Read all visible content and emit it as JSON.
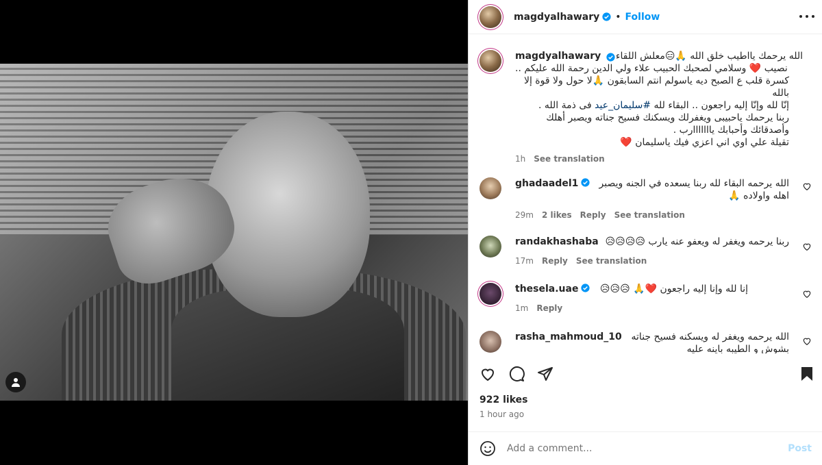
{
  "header": {
    "username": "magdyalhawary",
    "separator": "•",
    "follow_label": "Follow"
  },
  "caption": {
    "username": "magdyalhawary",
    "line1": "الله يرحمك يااطيب خلق الله 🙏😑معلش اللقاء",
    "line2": "نصيب ❤️ وسلامي لصحبك الحبيب علاء ولي الدين رحمة الله عليكم ..",
    "line3": "كسرة قلب ع الصبح ديه ياسولم انتم السابقون 🙏لا حول ولا قوة إلا بالله",
    "line4_pre": "إنّا لله وإنّا إليه راجعون .. البقاء لله ",
    "hashtag": "#سليمان_عيد",
    "line4_post": " فى ذمة الله .",
    "line5": "ربنا يرحمك ياحبيبى ويغفرلك ويسكنك فسيح جناته ويصبر أهلك",
    "line6": "وأصدقائك وأحبابك يااااااارب .",
    "line7": "تقيلة علي اوي اني اعزي فيك ياسليمان ❤️",
    "time": "1h",
    "see_translation": "See translation"
  },
  "comments": [
    {
      "username": "ghadaadel1",
      "verified": true,
      "text": "الله يرحمه البقاء لله ربنا يسعده في الجنه ويصبر اهله واولاده 🙏",
      "time": "29m",
      "likes": "2 likes",
      "reply": "Reply",
      "see_translation": "See translation"
    },
    {
      "username": "randakhashaba",
      "verified": false,
      "text": "ربنا يرحمه ويغفر له ويعفو عنه يارب 😥😥😥😥",
      "time": "17m",
      "reply": "Reply",
      "see_translation": "See translation"
    },
    {
      "username": "thesela.uae",
      "verified": true,
      "text": "إنا لله وإنا إليه راجعون ❤️🙏 😥😥😥",
      "time": "1m",
      "reply": "Reply"
    },
    {
      "username": "rasha_mahmoud_10",
      "verified": false,
      "text": "الله يرحمه ويغفر له ويسكنه فسيح جناته بشوش و الطيبه باينه عليه"
    }
  ],
  "actions": {
    "like_icon": "heart-outline-icon",
    "comment_icon": "comment-icon",
    "share_icon": "paper-plane-icon",
    "save_icon": "bookmark-icon"
  },
  "likes": "922 likes",
  "posted_ago": "1 hour ago",
  "add_comment": {
    "placeholder": "Add a comment...",
    "post_label": "Post"
  },
  "colors": {
    "accent": "#0095f6",
    "verified": "#0095f6",
    "muted": "#737373",
    "post_disabled": "#b2dffc"
  }
}
